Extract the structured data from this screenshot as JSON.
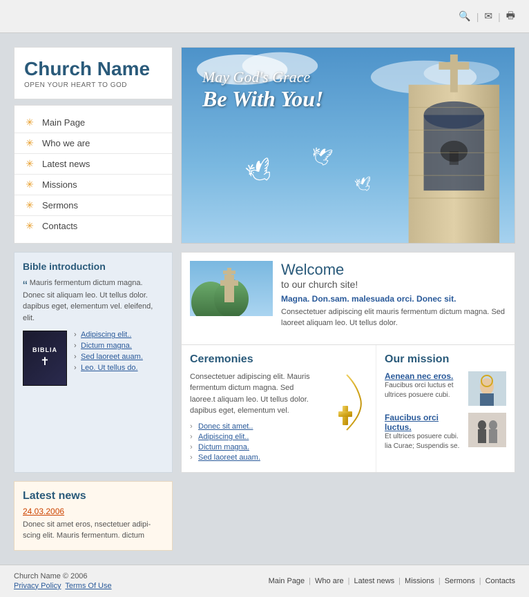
{
  "topbar": {
    "icons": [
      "search",
      "email",
      "print"
    ]
  },
  "logo": {
    "name": "Church Name",
    "tagline": "OPEN YOUR HEART TO GOD"
  },
  "nav": {
    "items": [
      {
        "label": "Main Page",
        "active": true
      },
      {
        "label": "Who we are"
      },
      {
        "label": "Latest news"
      },
      {
        "label": "Missions"
      },
      {
        "label": "Sermons"
      },
      {
        "label": "Contacts"
      }
    ]
  },
  "hero": {
    "line1": "May God's Grace",
    "line2": "Be With You!"
  },
  "bible_intro": {
    "heading": "Bible introduction",
    "quote": "Mauris fermentum dictum magna. Donec sit aliquam leo. Ut tellus dolor. dapibus eget, elementum vel. eleifend, elit.",
    "links": [
      "Adipiscing elit..",
      "Dictum magna.",
      "Sed laoreet auam.",
      "Leo. Ut tellus do."
    ]
  },
  "welcome": {
    "heading": "Welcome",
    "subheading": "to our church site!",
    "bold_text": "Magna. Don.sam. malesuada orci. Donec sit.",
    "body": "Consectetuer adipiscing elit mauris fermentum dictum magna. Sed laoreet aliquam leo. Ut tellus dolor."
  },
  "ceremonies": {
    "heading": "Ceremonies",
    "body": "Consectetuer adipiscing elit. Mauris fermentum dictum magna. Sed laoree.t aliquam leo. Ut tellus dolor. dapibus eget, elementum vel.",
    "links": [
      "Donec sit amet..",
      "Adipiscing elit..",
      "Dictum magna.",
      "Sed laoreet auam."
    ]
  },
  "mission": {
    "heading": "Our mission",
    "items": [
      {
        "title": "Aenean nec eros.",
        "body": "Faucibus orci luctus et ultrices posuere cubi."
      },
      {
        "title": "Faucibus orci luctus.",
        "body": "Et ultrices posuere cubi. lia Curae; Suspendis se."
      }
    ]
  },
  "latest_news": {
    "heading": "Latest news",
    "date": "24.03.2006",
    "body": "Donec sit amet eros, nsectetuer adipi-scing elit. Mauris fermentum. dictum"
  },
  "footer": {
    "copyright": "Church Name © 2006",
    "links": [
      "Privacy Policy",
      "Terms Of Use"
    ],
    "nav": [
      "Main Page",
      "Who are",
      "Latest news",
      "Missions",
      "Sermons",
      "Contacts"
    ]
  }
}
